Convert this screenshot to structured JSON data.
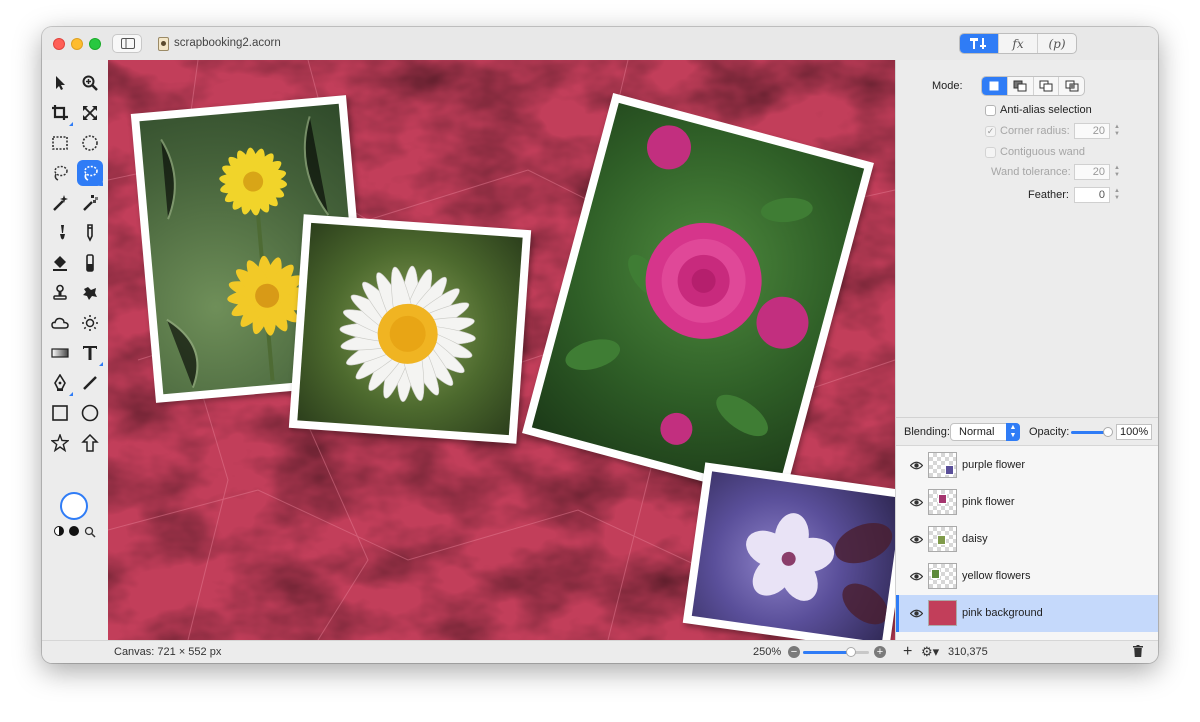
{
  "window": {
    "document_title": "scrapbooking2.acorn"
  },
  "top_segments": [
    {
      "label": ""
    },
    {
      "label": "fx"
    },
    {
      "label": "(p)"
    }
  ],
  "tools": [
    "arrow-tool",
    "zoom-tool",
    "crop-tool",
    "transform-tool",
    "rect-select-tool",
    "ellipse-select-tool",
    "lasso-tool",
    "magnetic-lasso-tool",
    "magic-wand-tool",
    "color-wand-tool",
    "brush-tool",
    "pencil-tool",
    "fill-tool",
    "eraser-tool",
    "clone-tool",
    "smudge-tool",
    "cloud-tool",
    "sun-tool",
    "gradient-tool",
    "text-tool",
    "pen-tool",
    "line-tool",
    "rect-tool",
    "oval-tool",
    "star-tool",
    "arrow-shape-tool"
  ],
  "inspector": {
    "mode_label": "Mode:",
    "antialias_label": "Anti-alias selection",
    "corner_radius_label": "Corner radius:",
    "corner_radius_value": "20",
    "contiguous_label": "Contiguous wand",
    "wand_tolerance_label": "Wand tolerance:",
    "wand_tolerance_value": "20",
    "feather_label": "Feather:",
    "feather_value": "0"
  },
  "layers_panel": {
    "blending_label": "Blending:",
    "blending_value": "Normal",
    "opacity_label": "Opacity:",
    "opacity_value": "100%",
    "layers": [
      {
        "name": "purple flower",
        "thumb_color": "#5a4f9a",
        "selected": false
      },
      {
        "name": "pink flower",
        "thumb_color": "#a4356e",
        "selected": false
      },
      {
        "name": "daisy",
        "thumb_color": "#7f9a4a",
        "selected": false
      },
      {
        "name": "yellow flowers",
        "thumb_color": "#5d8a3a",
        "selected": false
      },
      {
        "name": "pink background",
        "thumb_color": "#c23e5a",
        "selected": true
      }
    ]
  },
  "status": {
    "canvas_size": "Canvas: 721 × 552 px",
    "zoom": "250%",
    "zoom_fraction": 0.72,
    "coords": "310,375"
  },
  "colors": {
    "accent": "#2f7cf6",
    "background_paper": "#c23e5a"
  }
}
